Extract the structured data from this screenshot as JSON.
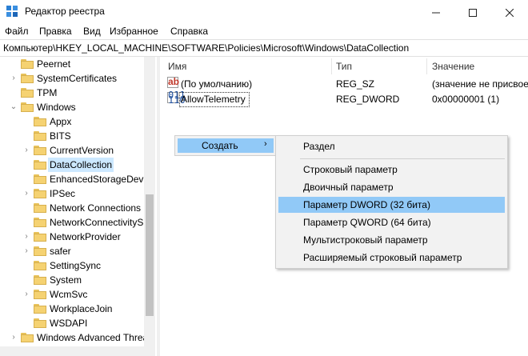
{
  "window": {
    "title": "Редактор реестра",
    "controls": [
      "minimize",
      "maximize",
      "close"
    ]
  },
  "menu": [
    "Файл",
    "Правка",
    "Вид",
    "Избранное",
    "Справка"
  ],
  "address": "Компьютер\\HKEY_LOCAL_MACHINE\\SOFTWARE\\Policies\\Microsoft\\Windows\\DataCollection",
  "tree": [
    {
      "label": "Peernet",
      "chevron": ""
    },
    {
      "label": "SystemCertificates",
      "chevron": "›"
    },
    {
      "label": "TPM",
      "chevron": ""
    },
    {
      "label": "Windows",
      "chevron": "⌄"
    },
    {
      "label": "Appx",
      "chevron": ""
    },
    {
      "label": "BITS",
      "chevron": ""
    },
    {
      "label": "CurrentVersion",
      "chevron": "›"
    },
    {
      "label": "DataCollection",
      "chevron": "",
      "selected": true
    },
    {
      "label": "EnhancedStorageDevic",
      "chevron": ""
    },
    {
      "label": "IPSec",
      "chevron": "›"
    },
    {
      "label": "Network Connections",
      "chevron": ""
    },
    {
      "label": "NetworkConnectivityS",
      "chevron": ""
    },
    {
      "label": "NetworkProvider",
      "chevron": "›"
    },
    {
      "label": "safer",
      "chevron": "›"
    },
    {
      "label": "SettingSync",
      "chevron": ""
    },
    {
      "label": "System",
      "chevron": ""
    },
    {
      "label": "WcmSvc",
      "chevron": "›"
    },
    {
      "label": "WorkplaceJoin",
      "chevron": ""
    },
    {
      "label": "WSDAPI",
      "chevron": ""
    },
    {
      "label": "Windows Advanced Threa",
      "chevron": "›"
    }
  ],
  "list": {
    "headers": {
      "name": "Имя",
      "type": "Тип",
      "value": "Значение"
    },
    "rows": [
      {
        "icon": "string-value-icon",
        "name": "(По умолчанию)",
        "type": "REG_SZ",
        "value": "(значение не присвое"
      },
      {
        "icon": "binary-value-icon",
        "name": "AllowTelemetry",
        "type": "REG_DWORD",
        "value": "0x00000001 (1)"
      }
    ]
  },
  "context_menu": {
    "parent": {
      "label": "Создать",
      "arrow": "›"
    },
    "submenu": [
      "Раздел",
      "Строковый параметр",
      "Двоичный параметр",
      "Параметр DWORD (32 бита)",
      "Параметр QWORD (64 бита)",
      "Мультистроковый параметр",
      "Расширяемый строковый параметр"
    ],
    "highlighted": "Параметр DWORD (32 бита)"
  },
  "colors": {
    "selection": "#cce8ff",
    "menu_highlight": "#91c9f7",
    "folder": "#f5d272"
  }
}
